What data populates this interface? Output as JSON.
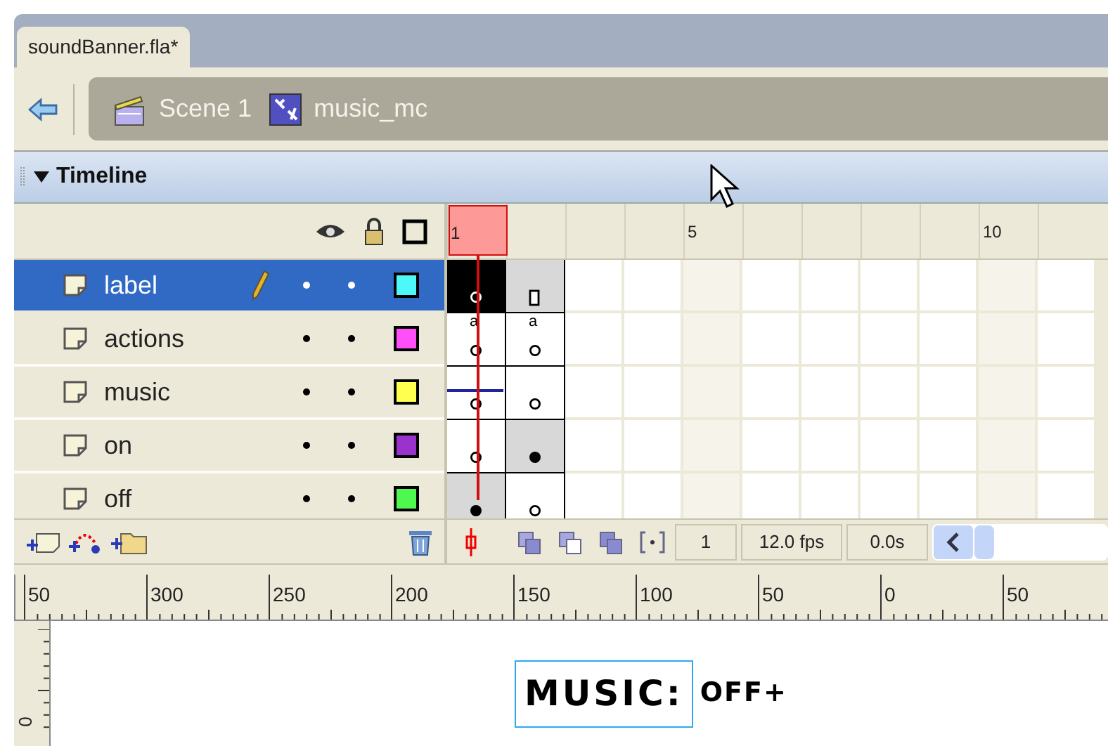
{
  "document_tab": {
    "title": "soundBanner.fla*",
    "selected": true
  },
  "breadcrumb": [
    {
      "kind": "scene",
      "label": "Scene 1"
    },
    {
      "kind": "symbol",
      "label": "music_mc"
    }
  ],
  "timeline": {
    "title": "Timeline",
    "expanded": true,
    "frame_numbers": [
      "1",
      "5",
      "10"
    ],
    "layers": [
      {
        "name": "label",
        "selected": true,
        "editing": true,
        "color": "#4ff8f8",
        "frames": [
          {
            "kind": "empty_key",
            "selected": true
          },
          {
            "kind": "end",
            "selected": false
          }
        ]
      },
      {
        "name": "actions",
        "selected": false,
        "editing": false,
        "color": "#ff4ff8",
        "frames": [
          {
            "kind": "empty_key",
            "selected": false,
            "script_mark": "a"
          },
          {
            "kind": "empty_key",
            "selected": false,
            "script_mark": "a"
          }
        ]
      },
      {
        "name": "music",
        "selected": false,
        "editing": false,
        "color": "#ffff4f",
        "frames": [
          {
            "kind": "empty_key",
            "selected": false,
            "sound": true
          },
          {
            "kind": "empty_key",
            "selected": false
          }
        ]
      },
      {
        "name": "on",
        "selected": false,
        "editing": false,
        "color": "#9933cc",
        "frames": [
          {
            "kind": "empty_key",
            "selected": false
          },
          {
            "kind": "filled_key",
            "selected": false
          }
        ]
      },
      {
        "name": "off",
        "selected": false,
        "editing": false,
        "color": "#4ff84f",
        "frames": [
          {
            "kind": "filled_key",
            "selected": false
          },
          {
            "kind": "empty_key",
            "selected": false
          }
        ]
      }
    ],
    "current_frame": "1",
    "frame_rate": "12.0 fps",
    "elapsed_time": "0.0s"
  },
  "stage": {
    "ruler_labels": [
      "50",
      "300",
      "250",
      "200",
      "150",
      "100",
      "50",
      "0",
      "50"
    ],
    "vertical_ruler_label": "0",
    "text_fields": [
      {
        "text": "MUSIC:",
        "selected": true
      },
      {
        "text": "OFF+",
        "selected": false
      }
    ]
  }
}
